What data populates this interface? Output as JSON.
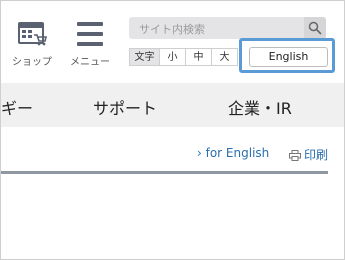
{
  "header": {
    "shop_label": "ショップ",
    "menu_label": "メニュー",
    "search": {
      "placeholder": "サイト内検索"
    },
    "font_size": {
      "label": "文字",
      "small": "小",
      "medium": "中",
      "large": "大"
    },
    "english_button": "English"
  },
  "nav": {
    "items": [
      "ギー",
      "サポート",
      "企業・IR"
    ]
  },
  "utility": {
    "for_english": "› for English",
    "print": "印刷"
  },
  "colors": {
    "highlight": "#5b9bd5",
    "link": "#2a6fb0",
    "nav_bg": "#f0f0f0",
    "rule": "#8e97a2"
  },
  "icons": [
    "shop-icon",
    "menu-icon",
    "search-icon",
    "printer-icon"
  ]
}
